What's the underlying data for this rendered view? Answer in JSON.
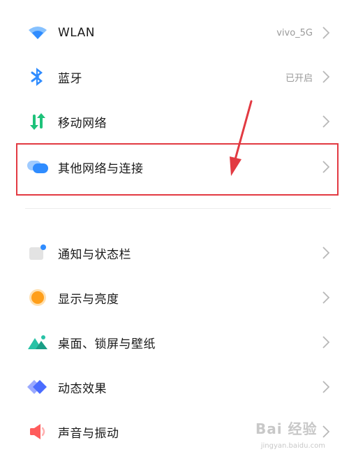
{
  "network_section": {
    "items": [
      {
        "label": "WLAN",
        "value": "vivo_5G",
        "icon": "wlan-icon"
      },
      {
        "label": "蓝牙",
        "value": "已开启",
        "icon": "bluetooth-icon"
      },
      {
        "label": "移动网络",
        "value": "",
        "icon": "mobile-network-icon"
      },
      {
        "label": "其他网络与连接",
        "value": "",
        "icon": "other-connections-icon"
      }
    ]
  },
  "system_section": {
    "items": [
      {
        "label": "通知与状态栏",
        "icon": "notification-icon"
      },
      {
        "label": "显示与亮度",
        "icon": "display-brightness-icon"
      },
      {
        "label": "桌面、锁屏与壁纸",
        "icon": "wallpaper-icon"
      },
      {
        "label": "动态效果",
        "icon": "animation-icon"
      },
      {
        "label": "声音与振动",
        "icon": "sound-vibration-icon"
      }
    ]
  },
  "annotation": {
    "highlighted_item": "其他网络与连接",
    "color": "#e23a42"
  },
  "watermark": {
    "main": "Bai 经验",
    "sub": "jingyan.baidu.com"
  },
  "colors": {
    "wlan": "#2f8cff",
    "bluetooth": "#2f8cff",
    "mobile": "#1ec27a",
    "other": "#2f8cff",
    "notification": "#e6e6e6",
    "display": "#ff9f1a",
    "wallpaper": "#28c2a6",
    "animation": "#4a6cff",
    "sound": "#ff5c5c"
  }
}
